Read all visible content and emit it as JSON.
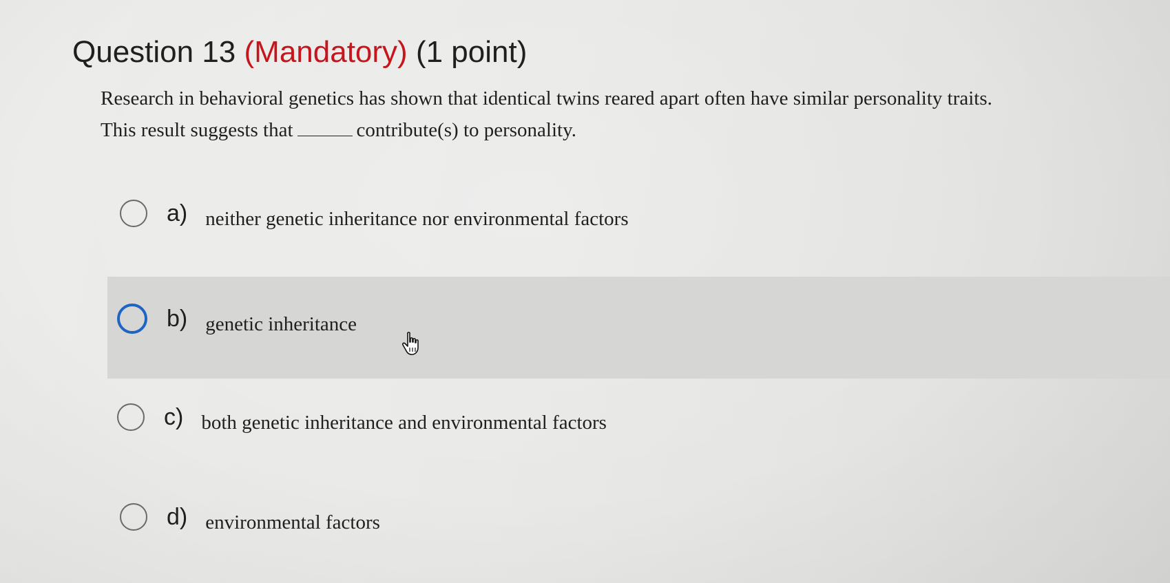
{
  "question": {
    "number_label": "Question 13",
    "mandatory_label": "(Mandatory)",
    "points_label": "(1 point)",
    "prompt_line1": "Research in behavioral genetics has shown that identical twins reared apart often have similar personality traits.",
    "prompt_line2_before": "This result suggests that",
    "prompt_line2_after": "contribute(s) to personality."
  },
  "options": [
    {
      "letter": "a)",
      "text": "neither genetic inheritance nor environmental factors",
      "selected": false
    },
    {
      "letter": "b)",
      "text": "genetic inheritance",
      "selected": false,
      "hovered": true
    },
    {
      "letter": "c)",
      "text": "both genetic inheritance and environmental factors",
      "selected": false
    },
    {
      "letter": "d)",
      "text": "environmental factors",
      "selected": false
    }
  ],
  "colors": {
    "mandatory": "#c5161d",
    "focus_ring": "#1f63c3",
    "hover_band": "#d6d6d4"
  },
  "icons": {
    "cursor": "hand-pointer-icon"
  }
}
